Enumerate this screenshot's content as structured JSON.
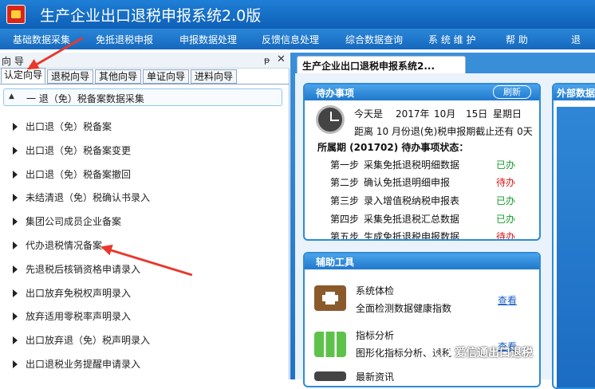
{
  "app": {
    "title": "生产企业出口退税申报系统2.0版"
  },
  "menu": [
    "基础数据采集",
    "免抵退税申报",
    "申报数据处理",
    "反馈信息处理",
    "综合数据查询",
    "系 统 维 护",
    "帮    助",
    "退"
  ],
  "left_pane": {
    "title": "向 导",
    "pin": "ᵽ",
    "close": "✕",
    "tabs": [
      "认定向导",
      "退税向导",
      "其他向导",
      "单证向导",
      "进料向导"
    ],
    "tree_head": "一  退（免）税备案数据采集",
    "items": [
      "出口退（免）税备案",
      "出口退（免）税备案变更",
      "出口退（免）税备案撤回",
      "未结清退（免）税确认书录入",
      "集团公司成员企业备案",
      "代办退税情况备案",
      "先退税后核销资格申请录入",
      "出口放弃免税权声明录入",
      "放弃适用零税率声明录入",
      "出口放弃退（免）税声明录入",
      "出口退税业务提醒申请录入"
    ]
  },
  "right_pane": {
    "doc_tab": "生产企业出口退税申报系统2...",
    "todo": {
      "title": "待办事项",
      "refresh": "刷新",
      "today_prefix": "今天是",
      "year": "2017年",
      "month": "10月",
      "day": "15日",
      "weekday": "星期日",
      "deadline_text": "距离 10 月份退(免)税申报期截止还有  0天",
      "period_text": "所属期 (201702) 待办事项状态：",
      "steps": [
        {
          "step": "第一步",
          "desc": "采集免抵退税明细数据",
          "status": "已办"
        },
        {
          "step": "第二步",
          "desc": "确认免抵退明细申报",
          "status": "待办"
        },
        {
          "step": "第三步",
          "desc": "录入增值税纳税申报表",
          "status": "已办"
        },
        {
          "step": "第四步",
          "desc": "采集免抵退税汇总数据",
          "status": "已办"
        },
        {
          "step": "第五步",
          "desc": "生成免抵退税申报数据",
          "status": "待办"
        }
      ]
    },
    "tools": {
      "title": "辅助工具",
      "items": [
        {
          "name": "系统体检",
          "desc": "全面检测数据健康指数",
          "link": "查看"
        },
        {
          "name": "指标分析",
          "desc": "图形化指标分析、退税",
          "link": "查看"
        },
        {
          "name": "最新资讯",
          "desc": "",
          "link": ""
        }
      ]
    },
    "external": {
      "title": "外部数据"
    }
  },
  "watermark": "爱信通出口退税",
  "colors": {
    "done": "#169a2a",
    "todo": "#d01818",
    "accent": "#1f7fd6",
    "arrow": "#e8382d"
  }
}
